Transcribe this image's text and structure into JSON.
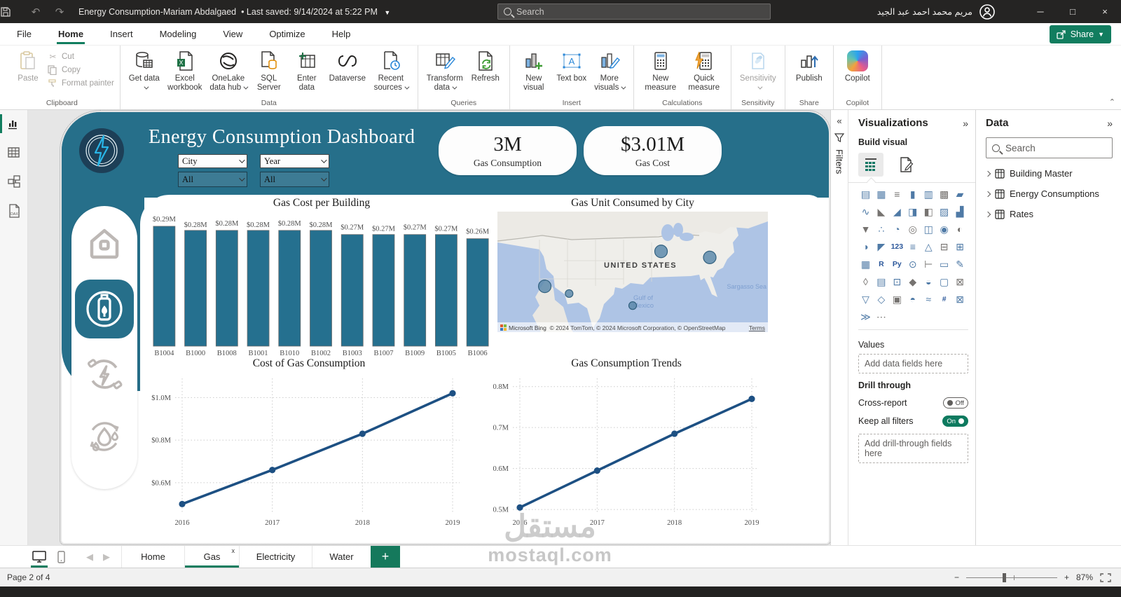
{
  "titlebar": {
    "title": "Energy Consumption-Mariam Abdalgaed",
    "saved": "Last saved: 9/14/2024 at 5:22 PM",
    "search_placeholder": "Search",
    "user_name": "مريم محمد احمد عبد الجيد"
  },
  "menubar": {
    "items": [
      "File",
      "Home",
      "Insert",
      "Modeling",
      "View",
      "Optimize",
      "Help"
    ],
    "share": "Share"
  },
  "ribbon": {
    "clipboard": {
      "group": "Clipboard",
      "paste": "Paste",
      "cut": "Cut",
      "copy": "Copy",
      "format_painter": "Format painter"
    },
    "data": {
      "group": "Data",
      "get_data": "Get data",
      "excel": "Excel workbook",
      "onelake": "OneLake data hub",
      "sql": "SQL Server",
      "enter": "Enter data",
      "dataverse": "Dataverse",
      "recent": "Recent sources"
    },
    "queries": {
      "group": "Queries",
      "transform": "Transform data",
      "refresh": "Refresh"
    },
    "insert_group": {
      "group": "Insert",
      "new_visual": "New visual",
      "text_box": "Text box",
      "more_visuals": "More visuals"
    },
    "calculations": {
      "group": "Calculations",
      "new_measure": "New measure",
      "quick_measure": "Quick measure"
    },
    "sensitivity": {
      "group": "Sensitivity",
      "sensitivity": "Sensitivity"
    },
    "share_group": {
      "group": "Share",
      "publish": "Publish"
    },
    "copilot": {
      "group": "Copilot",
      "copilot": "Copilot"
    }
  },
  "dashboard": {
    "title": "Energy Consumption Dashboard",
    "slicers": [
      {
        "header": "City",
        "value": "All"
      },
      {
        "header": "Year",
        "value": "All"
      }
    ],
    "kpis": [
      {
        "value": "3M",
        "label": "Gas Consumption"
      },
      {
        "value": "$3.01M",
        "label": "Gas Cost"
      }
    ]
  },
  "chart_data": [
    {
      "type": "bar",
      "title": "Gas Cost per Building",
      "categories": [
        "B1004",
        "B1000",
        "B1008",
        "B1001",
        "B1010",
        "B1002",
        "B1003",
        "B1007",
        "B1009",
        "B1005",
        "B1006"
      ],
      "values": [
        0.29,
        0.28,
        0.28,
        0.28,
        0.28,
        0.28,
        0.27,
        0.27,
        0.27,
        0.27,
        0.26
      ],
      "labels": [
        "$0.29M",
        "$0.28M",
        "$0.28M",
        "$0.28M",
        "$0.28M",
        "$0.28M",
        "$0.27M",
        "$0.27M",
        "$0.27M",
        "$0.27M",
        "$0.26M"
      ],
      "ylim": [
        0,
        0.3
      ],
      "bar_color": "#25708f"
    },
    {
      "type": "map",
      "title": "Gas Unit Consumed by City",
      "points": [
        {
          "x_pct": 17.5,
          "y_pct": 62,
          "r": 9
        },
        {
          "x_pct": 26.5,
          "y_pct": 68,
          "r": 5.5
        },
        {
          "x_pct": 50.0,
          "y_pct": 78,
          "r": 5.5
        },
        {
          "x_pct": 60.5,
          "y_pct": 33,
          "r": 9
        },
        {
          "x_pct": 78.5,
          "y_pct": 38,
          "r": 9
        }
      ],
      "bubble_color": "#5d89ab"
    },
    {
      "type": "line",
      "title": "Cost of Gas Consumption",
      "x": [
        "2016",
        "2017",
        "2018",
        "2019"
      ],
      "values": [
        0.5,
        0.66,
        0.83,
        1.02
      ],
      "yticks": [
        0.6,
        0.8,
        1.0
      ],
      "ytick_labels": [
        "$0.6M",
        "$0.8M",
        "$1.0M"
      ],
      "ylim": [
        0.455,
        1.09
      ],
      "line_color": "#1d5083"
    },
    {
      "type": "line",
      "title": "Gas Consumption Trends",
      "x": [
        "2016",
        "2017",
        "2018",
        "2019"
      ],
      "values": [
        0.505,
        0.595,
        0.685,
        0.77
      ],
      "yticks": [
        0.5,
        0.6,
        0.7,
        0.8
      ],
      "ytick_labels": [
        "0.5M",
        "0.6M",
        "0.7M",
        "0.8M"
      ],
      "ylim": [
        0.49,
        0.82
      ],
      "line_color": "#1d5083"
    }
  ],
  "map_meta": {
    "provider": "Microsoft Bing",
    "country_label": "UNITED STATES",
    "gulf_label": "Gulf of Mexico",
    "sargasso_label": "Sargasso Sea",
    "attribution": "© 2024 TomTom, © 2024 Microsoft Corporation, © OpenStreetMap",
    "terms": "Terms"
  },
  "filters_panel": {
    "title": "Filters"
  },
  "viz_panel": {
    "title": "Visualizations",
    "build_visual": "Build visual",
    "values_label": "Values",
    "add_data": "Add data fields here",
    "drill_through": "Drill through",
    "cross_report": "Cross-report",
    "off_label": "Off",
    "keep_filters": "Keep all filters",
    "on_label": "On",
    "add_drill": "Add drill-through fields here",
    "gallery": [
      {
        "n": "stacked-bar-chart",
        "g": "▤"
      },
      {
        "n": "stacked-column-chart",
        "g": "▦"
      },
      {
        "n": "clustered-bar-chart",
        "g": "≡"
      },
      {
        "n": "clustered-column-chart",
        "g": "▮"
      },
      {
        "n": "100-stacked-bar-chart",
        "g": "▥"
      },
      {
        "n": "100-stacked-column-chart",
        "g": "▩"
      },
      {
        "n": "ribbon-chart",
        "g": "▰"
      },
      {
        "n": "line-chart",
        "g": "∿"
      },
      {
        "n": "area-chart",
        "g": "◣"
      },
      {
        "n": "stacked-area-chart",
        "g": "◢"
      },
      {
        "n": "line-and-stacked-column-chart",
        "g": "◨"
      },
      {
        "n": "line-and-clustered-column-chart",
        "g": "◧"
      },
      {
        "n": "combo-chart",
        "g": "▨"
      },
      {
        "n": "waterfall-chart",
        "g": "▟"
      },
      {
        "n": "funnel-chart",
        "g": "▼"
      },
      {
        "n": "scatter-chart",
        "g": "∴"
      },
      {
        "n": "pie-chart",
        "g": "◔"
      },
      {
        "n": "donut-chart",
        "g": "◎"
      },
      {
        "n": "treemap",
        "g": "◫"
      },
      {
        "n": "map",
        "g": "◉"
      },
      {
        "n": "filled-map",
        "g": "◐"
      },
      {
        "n": "shape-map",
        "g": "◑"
      },
      {
        "n": "azure-map",
        "g": "◤"
      },
      {
        "n": "card",
        "g": "123",
        "t": 1
      },
      {
        "n": "multi-row-card",
        "g": "≡"
      },
      {
        "n": "kpi",
        "g": "△"
      },
      {
        "n": "slicer",
        "g": "⊟"
      },
      {
        "n": "table",
        "g": "⊞"
      },
      {
        "n": "matrix",
        "g": "▦"
      },
      {
        "n": "r-script-visual",
        "g": "R",
        "t": 1
      },
      {
        "n": "python-visual",
        "g": "Py",
        "t": 1
      },
      {
        "n": "key-influencers",
        "g": "⊙"
      },
      {
        "n": "decomposition-tree",
        "g": "⊢"
      },
      {
        "n": "qa-visual",
        "g": "▭"
      },
      {
        "n": "smart-narrative",
        "g": "✎"
      },
      {
        "n": "metrics",
        "g": "◊"
      },
      {
        "n": "paginated-report",
        "g": "▤"
      },
      {
        "n": "power-apps",
        "g": "⊡"
      },
      {
        "n": "arcgis-map",
        "g": "◆"
      },
      {
        "n": "gauge",
        "g": "◒"
      },
      {
        "n": "new-card",
        "g": "▢"
      },
      {
        "n": "new-slicer",
        "g": "⊠"
      },
      {
        "n": "text-filter",
        "g": "▽"
      },
      {
        "n": "shape-visual",
        "g": "◇"
      },
      {
        "n": "image-visual",
        "g": "▣"
      },
      {
        "n": "gauge-half",
        "g": "◓"
      },
      {
        "n": "custom-visual-1",
        "g": "≈"
      },
      {
        "n": "custom-visual-2",
        "g": "#",
        "t": 1
      },
      {
        "n": "custom-visual-3",
        "g": "⊠"
      },
      {
        "n": "power-automate",
        "g": "≫"
      },
      {
        "n": "more-visuals-ellipsis",
        "g": "⋯"
      }
    ]
  },
  "data_panel": {
    "title": "Data",
    "search_placeholder": "Search",
    "tables": [
      "Building Master",
      "Energy Consumptions",
      "Rates"
    ]
  },
  "footer": {
    "tabs": [
      "Home",
      "Gas",
      "Electricity",
      "Water"
    ],
    "active_tab": "Gas",
    "page_status": "Page 2 of 4",
    "zoom": "87%"
  },
  "watermark": {
    "line1": "مستقل",
    "line2": "mostaql.com"
  },
  "colors": {
    "accent_green": "#117d5f",
    "teal": "#266f8a",
    "bar": "#25708f",
    "line": "#1d5083",
    "toggle_on": "#0e7a5f"
  }
}
